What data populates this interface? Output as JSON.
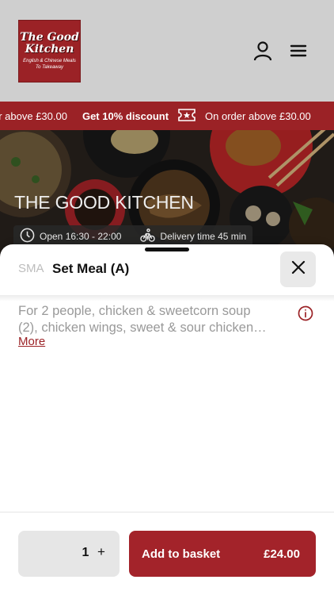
{
  "header": {
    "logo": {
      "title_line1": "The Good",
      "title_line2": "Kitchen",
      "subtitle_line1": "English & Chinese Meals",
      "subtitle_line2": "To Takeaway"
    },
    "icons": [
      "user-icon",
      "hamburger-menu-icon"
    ]
  },
  "promo": {
    "text_left": "er above £30.00",
    "text_bold": "Get 10% discount",
    "text_right": "On order above £30.00",
    "icon": "ticket-star-icon"
  },
  "hero": {
    "title": "THE GOOD KITCHEN",
    "open_hours": "Open 16:30 - 22:00",
    "delivery": "Delivery time 45 min",
    "icons": [
      "clock-icon",
      "bike-icon"
    ]
  },
  "item_sheet": {
    "sku": "SMA",
    "name": "Set Meal (A)",
    "description_line1": "For 2 people, chicken & sweetcorn soup",
    "description_line2": "(2), chicken wings, sweet & sour chicken…",
    "more_label": "More",
    "icons": [
      "close-icon",
      "info-icon"
    ]
  },
  "footer": {
    "quantity": "1",
    "plus_label": "+",
    "add_label": "Add to basket",
    "price": "£24.00"
  },
  "colors": {
    "brand_red": "#9b2226",
    "header_grey": "#cfcfcf",
    "stepper_grey": "#e6e6e6"
  }
}
